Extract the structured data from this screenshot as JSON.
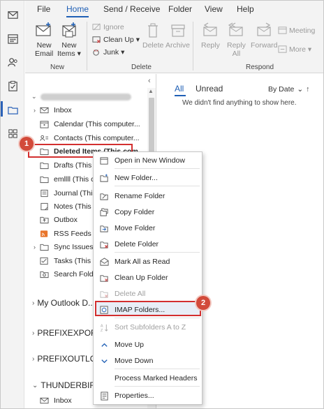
{
  "ribbon": {
    "tabs": [
      {
        "label": "File"
      },
      {
        "label": "Home"
      },
      {
        "label": "Send / Receive"
      },
      {
        "label": "Folder"
      },
      {
        "label": "View"
      },
      {
        "label": "Help"
      }
    ],
    "active_tab": "Home",
    "groups": {
      "new": {
        "label": "New",
        "new_email": {
          "line1": "New",
          "line2": "Email"
        },
        "new_items": {
          "line1": "New",
          "line2": "Items ▾"
        }
      },
      "delete": {
        "label": "Delete",
        "ignore": "Ignore",
        "clean_up": "Clean Up ▾",
        "junk": "Junk ▾",
        "delete": "Delete",
        "archive": "Archive"
      },
      "respond": {
        "label": "Respond",
        "reply": "Reply",
        "reply_all": {
          "line1": "Reply",
          "line2": "All"
        },
        "forward": "Forward",
        "meeting": "Meeting",
        "more": "More ▾"
      }
    }
  },
  "folders": [
    {
      "label": "Inbox",
      "icon": "inbox-icon",
      "expandable": true
    },
    {
      "label": "Calendar (This computer...",
      "icon": "calendar-icon",
      "expandable": false
    },
    {
      "label": "Contacts (This computer...",
      "icon": "contacts-icon",
      "expandable": false
    },
    {
      "label": "Deleted Items (This com...",
      "icon": "folder-icon",
      "expandable": false,
      "selected": true
    },
    {
      "label": "Drafts (This c...",
      "icon": "folder-icon",
      "expandable": false
    },
    {
      "label": "emllll (This c...",
      "icon": "folder-icon",
      "expandable": false
    },
    {
      "label": "Journal (This...",
      "icon": "journal-icon",
      "expandable": false
    },
    {
      "label": "Notes (This c...",
      "icon": "notes-icon",
      "expandable": false
    },
    {
      "label": "Outbox",
      "icon": "outbox-icon",
      "expandable": false
    },
    {
      "label": "RSS Feeds",
      "icon": "rss-icon",
      "expandable": false
    },
    {
      "label": "Sync Issues (T...",
      "icon": "folder-icon",
      "expandable": true
    },
    {
      "label": "Tasks (This co...",
      "icon": "tasks-icon",
      "expandable": false
    },
    {
      "label": "Search Folder...",
      "icon": "search-folder-icon",
      "expandable": false
    }
  ],
  "sections": [
    {
      "label": "My Outlook D..."
    },
    {
      "label": "PREFIXEXPORT..."
    },
    {
      "label": "PREFIXOUTLO..."
    },
    {
      "label": "THUNDERBIRD..."
    }
  ],
  "thunderbird_inbox": "Inbox",
  "message_list": {
    "tab_all": "All",
    "tab_unread": "Unread",
    "sort": "By Date",
    "empty": "We didn't find anything to show here."
  },
  "context_menu": {
    "items": [
      {
        "label": "Open in New Window",
        "icon": "open-window-icon",
        "disabled": false
      },
      {
        "label": "New Folder...",
        "icon": "new-folder-icon",
        "disabled": false
      },
      {
        "label": "Rename Folder",
        "icon": "rename-folder-icon",
        "disabled": false
      },
      {
        "label": "Copy Folder",
        "icon": "copy-folder-icon",
        "disabled": false
      },
      {
        "label": "Move Folder",
        "icon": "move-folder-icon",
        "disabled": false
      },
      {
        "label": "Delete Folder",
        "icon": "delete-folder-icon",
        "disabled": false
      },
      {
        "label": "Mark All as Read",
        "icon": "mark-read-icon",
        "disabled": false
      },
      {
        "label": "Clean Up Folder",
        "icon": "clean-up-icon",
        "disabled": false
      },
      {
        "label": "Delete All",
        "icon": "delete-all-icon",
        "disabled": true
      },
      {
        "label": "IMAP Folders...",
        "icon": "imap-folders-icon",
        "disabled": false,
        "highlighted": true
      },
      {
        "label": "Sort Subfolders A to Z",
        "icon": "sort-az-icon",
        "disabled": true
      },
      {
        "label": "Move Up",
        "icon": "move-up-icon",
        "disabled": false
      },
      {
        "label": "Move Down",
        "icon": "move-down-icon",
        "disabled": false
      },
      {
        "label": "Process Marked Headers",
        "icon": "",
        "disabled": false
      },
      {
        "label": "Properties...",
        "icon": "properties-icon",
        "disabled": false
      }
    ]
  },
  "callouts": [
    "1",
    "2"
  ],
  "colors": {
    "accent": "#1f5fb5",
    "callout": "#d24a3a",
    "highlight_border": "#d32f2f"
  }
}
